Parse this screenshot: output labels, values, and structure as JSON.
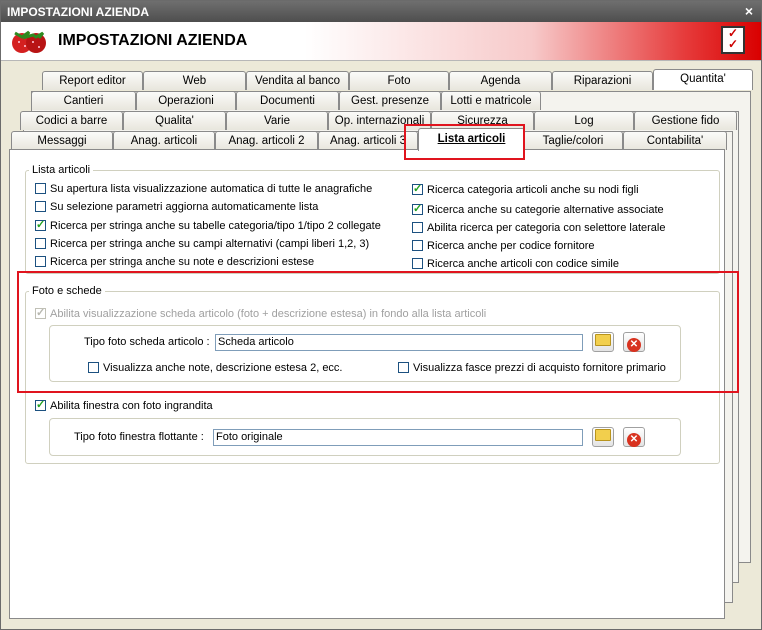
{
  "window": {
    "title": "IMPOSTAZIONI AZIENDA",
    "close": "×"
  },
  "header": {
    "title": "IMPOSTAZIONI AZIENDA"
  },
  "tabs_row1": [
    "Report editor",
    "Web",
    "Vendita al banco",
    "Foto",
    "Agenda",
    "Riparazioni",
    "Quantita'"
  ],
  "tabs_row2": [
    "Cantieri",
    "Operazioni",
    "Documenti",
    "Gest. presenze",
    "Lotti e matricole"
  ],
  "tabs_row3": [
    "Codici a barre",
    "Qualita'",
    "Varie",
    "Op. internazionali",
    "Sicurezza",
    "Log",
    "Gestione fido"
  ],
  "tabs_row4": [
    "Messaggi",
    "Anag. articoli",
    "Anag. articoli 2",
    "Anag. articoli 3",
    "Lista articoli",
    "Taglie/colori",
    "Contabilita'"
  ],
  "lista": {
    "group_label": "Lista articoli",
    "left": [
      {
        "label": "Su apertura lista visualizzazione automatica di tutte le anagrafiche",
        "checked": false
      },
      {
        "label": "Su selezione parametri aggiorna automaticamente lista",
        "checked": false
      },
      {
        "label": "Ricerca per stringa anche su tabelle categoria/tipo 1/tipo 2 collegate",
        "checked": true
      },
      {
        "label": "Ricerca per stringa anche su campi alternativi (campi liberi 1,2, 3)",
        "checked": false
      },
      {
        "label": "Ricerca per stringa anche su note e descrizioni estese",
        "checked": false
      }
    ],
    "right": [
      {
        "label": "Ricerca categoria articoli anche su nodi figli",
        "checked": true
      },
      {
        "label": "Ricerca anche su categorie alternative associate",
        "checked": true
      },
      {
        "label": "Abilita ricerca per categoria con selettore laterale",
        "checked": false
      },
      {
        "label": "Ricerca anche per codice fornitore",
        "checked": false
      },
      {
        "label": "Ricerca anche articoli con codice simile",
        "checked": false
      }
    ]
  },
  "foto": {
    "group_label": "Foto e schede",
    "abilita_scheda": "Abilita visualizzazione scheda articolo (foto + descrizione estesa) in fondo alla lista articoli",
    "tipo_foto_label": "Tipo foto scheda articolo :",
    "tipo_foto_value": "Scheda articolo",
    "visualizza_note": "Visualizza anche note, descrizione estesa 2, ecc.",
    "visualizza_fasce": "Visualizza fasce prezzi di acquisto fornitore primario",
    "abilita_finestra": "Abilita finestra con foto ingrandita",
    "tipo_finestra_label": "Tipo foto finestra flottante :",
    "tipo_finestra_value": "Foto originale"
  },
  "colors": {
    "highlight": "#e0141e",
    "title_bar": "#555555"
  }
}
